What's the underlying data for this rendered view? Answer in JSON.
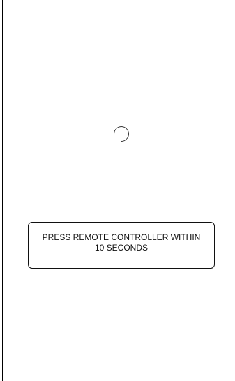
{
  "loading": {
    "icon": "loading-spinner-icon"
  },
  "message": {
    "text": "PRESS REMOTE CONTROLLER WITHIN 10 SECONDS"
  }
}
